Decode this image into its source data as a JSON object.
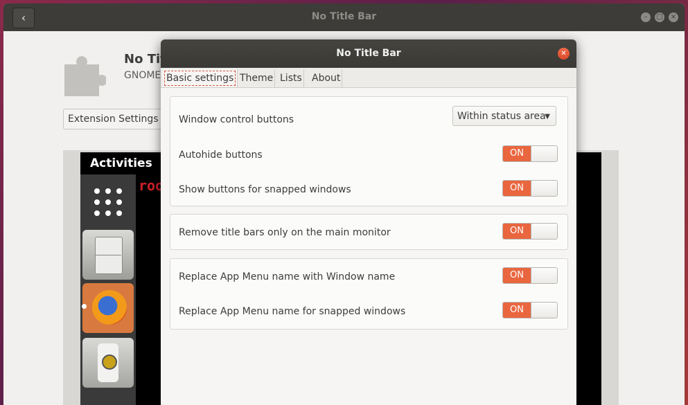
{
  "background_window": {
    "title": "No Title Bar",
    "back_glyph": "‹",
    "app_name": "No Tit",
    "app_subtitle": "GNOME",
    "extension_settings_label": "Extension Settings",
    "screenshot": {
      "activities_label": "Activities",
      "red_text": "roo"
    }
  },
  "dialog": {
    "title": "No Title Bar",
    "close_glyph": "✕",
    "tabs": [
      {
        "label": "Basic settings",
        "active": true
      },
      {
        "label": "Theme",
        "active": false
      },
      {
        "label": "Lists",
        "active": false
      },
      {
        "label": "About",
        "active": false
      }
    ],
    "groups": [
      {
        "rows": [
          {
            "label": "Window control buttons",
            "control": "combo",
            "value": "Within status area"
          },
          {
            "label": "Autohide buttons",
            "control": "switch",
            "value": "ON"
          },
          {
            "label": "Show buttons for snapped windows",
            "control": "switch",
            "value": "ON"
          }
        ]
      },
      {
        "rows": [
          {
            "label": "Remove title bars only on the main monitor",
            "control": "switch",
            "value": "ON"
          }
        ]
      },
      {
        "rows": [
          {
            "label": "Replace App Menu name with Window name",
            "control": "switch",
            "value": "ON"
          },
          {
            "label": "Replace App Menu name for snapped windows",
            "control": "switch",
            "value": "ON"
          }
        ]
      }
    ]
  },
  "colors": {
    "switch_on": "#e9663f",
    "close_button": "#e4532f",
    "titlebar": "#3d3c38"
  },
  "icons": [
    "back-arrow-icon",
    "minimize-icon",
    "maximize-icon",
    "close-icon",
    "puzzle-icon",
    "dropdown-arrow-icon"
  ]
}
